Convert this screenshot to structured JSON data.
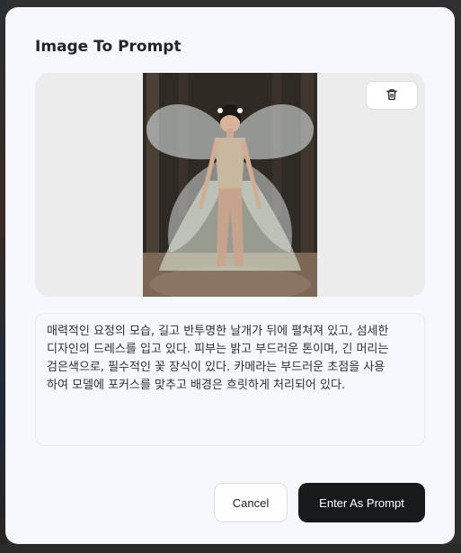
{
  "modal": {
    "title": "Image To Prompt"
  },
  "image_panel": {
    "delete_icon": "trash-icon"
  },
  "prompt": {
    "text": "매력적인 요정의 모습, 길고 반투명한 날개가 뒤에 펼쳐져 있고, 섬세한\n디자인의 드레스를 입고 있다. 피부는 밝고 부드러운 톤이며, 긴 머리는\n검은색으로, 필수적인 꽃 장식이 있다. 카메라는 부드러운 초점을 사용\n하여 모델에 포커스를 맞추고 배경은 흐릿하게 처리되어 있다."
  },
  "actions": {
    "cancel_label": "Cancel",
    "enter_label": "Enter As Prompt"
  },
  "colors": {
    "modal_bg": "#f5f9fd",
    "primary_button": "#18191c",
    "panel_bg": "#ececec"
  }
}
